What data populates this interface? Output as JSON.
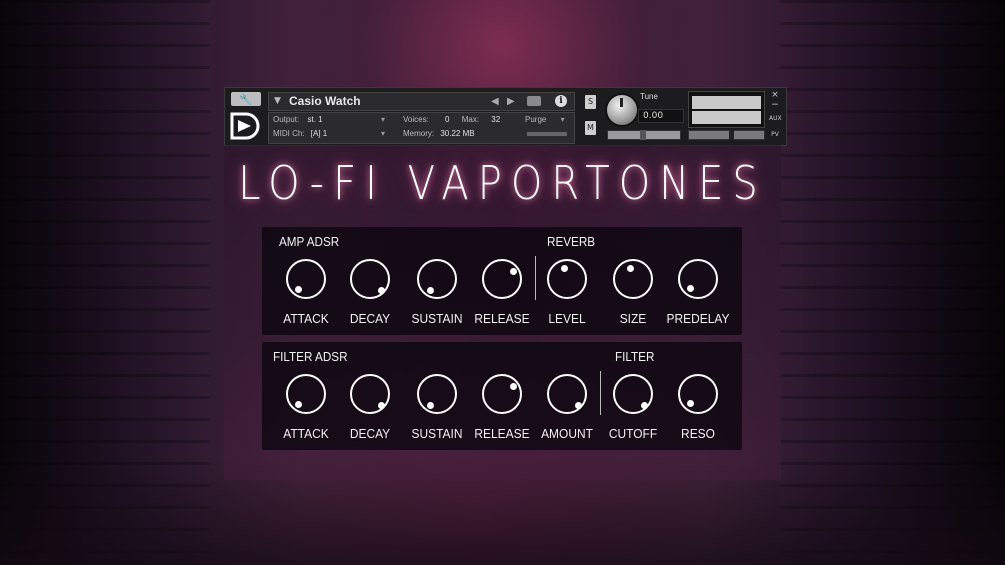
{
  "header": {
    "instrument_name": "Casio Watch",
    "output_label": "Output:",
    "output_value": "st. 1",
    "voices_label": "Voices:",
    "voices_value": "0",
    "max_label": "Max:",
    "max_value": "32",
    "purge_label": "Purge",
    "midi_label": "MIDI Ch:",
    "midi_value": "[A]  1",
    "memory_label": "Memory:",
    "memory_value": "30.22 MB",
    "solo_label": "S",
    "mute_label": "M",
    "tune_label": "Tune",
    "tune_value": "0.00",
    "aux_label": "AUX",
    "pv_label": "PV",
    "close_label": "×",
    "minimize_label": "−"
  },
  "title": "LO-FI VAPORTONES",
  "amp_panel": {
    "label": "AMP ADSR",
    "reverb_label": "REVERB",
    "knobs": [
      {
        "label": "ATTACK"
      },
      {
        "label": "DECAY"
      },
      {
        "label": "SUSTAIN"
      },
      {
        "label": "RELEASE"
      },
      {
        "label": "LEVEL"
      },
      {
        "label": "SIZE"
      },
      {
        "label": "PREDELAY"
      }
    ]
  },
  "filter_panel": {
    "label": "FILTER ADSR",
    "filter_label": "FILTER",
    "knobs": [
      {
        "label": "ATTACK"
      },
      {
        "label": "DECAY"
      },
      {
        "label": "SUSTAIN"
      },
      {
        "label": "RELEASE"
      },
      {
        "label": "AMOUNT"
      },
      {
        "label": "CUTOFF"
      },
      {
        "label": "RESO"
      }
    ]
  },
  "colors": {
    "glow": "#e85096",
    "panel_bg": "#0a060e",
    "knob": "#ffffff"
  }
}
